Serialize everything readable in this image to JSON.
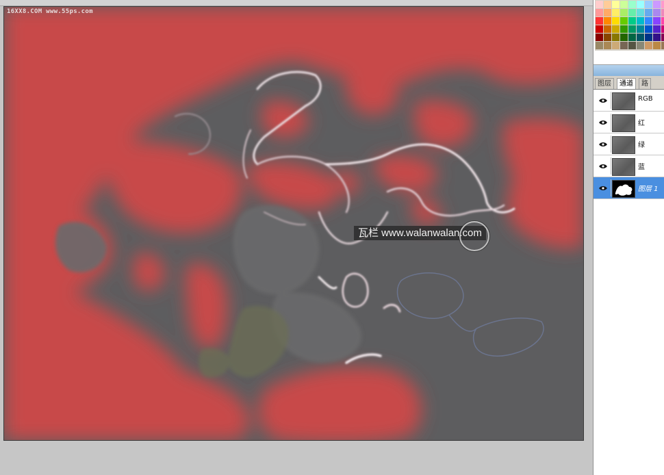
{
  "canvas": {
    "source_watermark": "16XX8.COM  www.55ps.com",
    "site_watermark": "瓦栏 www.walanwalan.com",
    "colors": {
      "background_gray": "#5d5d5f",
      "mask_red": "#c8494a",
      "highlight": "#e9d8dd"
    }
  },
  "panel": {
    "tabs": [
      {
        "label": "图层",
        "active": false
      },
      {
        "label": "通道",
        "active": true
      },
      {
        "label": "路",
        "active": false
      }
    ],
    "channels": [
      {
        "name": "RGB",
        "icon": "eye-icon",
        "selected": false
      },
      {
        "name": "红",
        "icon": "eye-icon",
        "selected": false
      },
      {
        "name": "绿",
        "icon": "eye-icon",
        "selected": false
      },
      {
        "name": "蓝",
        "icon": "eye-icon",
        "selected": false
      },
      {
        "name": "图层 1",
        "icon": "eye-icon",
        "selected": true
      }
    ],
    "swatch_colors": [
      "#ffcccc",
      "#ffcc99",
      "#ffff99",
      "#ccff99",
      "#99ffcc",
      "#99ffff",
      "#99ccff",
      "#cc99ff",
      "#ff99cc",
      "#ff9999",
      "#ffaa66",
      "#ffee66",
      "#aaee66",
      "#66eeaa",
      "#66dddd",
      "#66aaee",
      "#aa88ee",
      "#ee88bb",
      "#ff3333",
      "#ff8800",
      "#ffdd00",
      "#66cc00",
      "#00cc88",
      "#00bbcc",
      "#3388ff",
      "#8844ff",
      "#ff44aa",
      "#cc0000",
      "#cc6600",
      "#ccaa00",
      "#339900",
      "#009966",
      "#008899",
      "#0055cc",
      "#5522cc",
      "#cc0077",
      "#880000",
      "#884400",
      "#887700",
      "#226600",
      "#006644",
      "#005566",
      "#003388",
      "#331188",
      "#880055",
      "#998866",
      "#aa8855",
      "#ccaa77",
      "#776655",
      "#555544",
      "#888877",
      "#cc9966",
      "#bb8844",
      "#997755"
    ]
  }
}
